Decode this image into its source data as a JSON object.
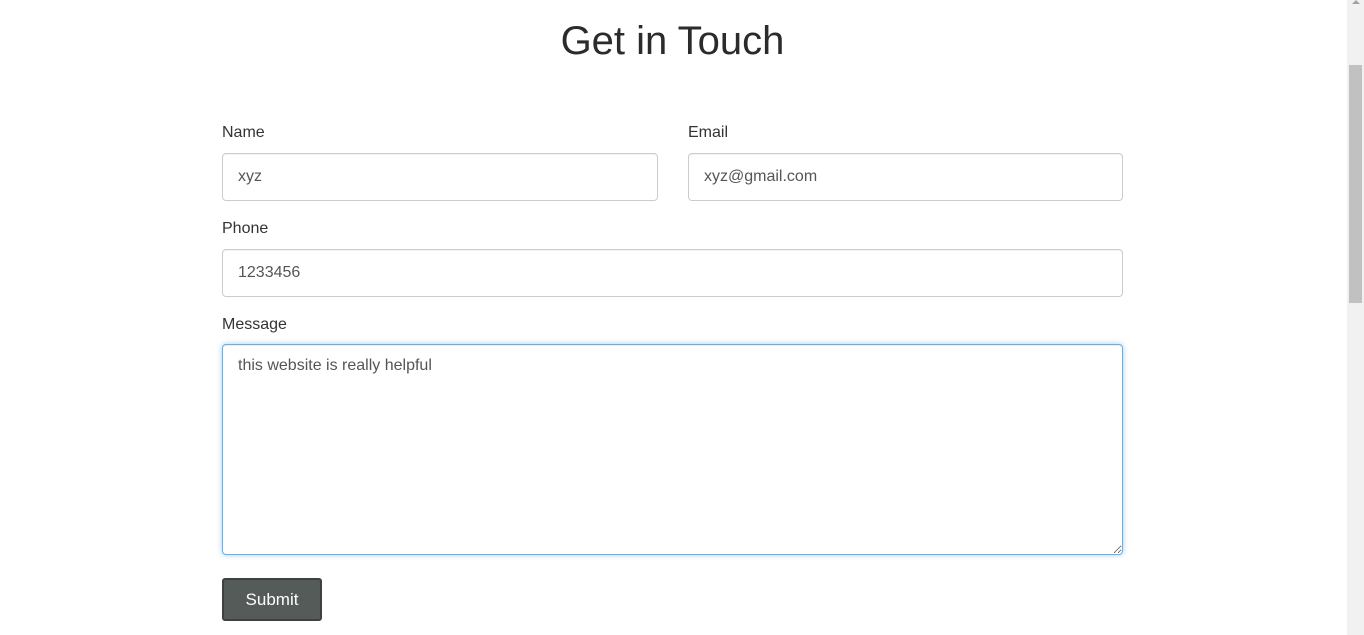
{
  "page": {
    "title": "Get in Touch"
  },
  "form": {
    "name": {
      "label": "Name",
      "value": "xyz"
    },
    "email": {
      "label": "Email",
      "value": "xyz@gmail.com"
    },
    "phone": {
      "label": "Phone",
      "value": "1233456"
    },
    "message": {
      "label": "Message",
      "value": "this website is really helpful"
    },
    "submit_label": "Submit"
  },
  "colors": {
    "focus_border": "#66afe9",
    "button_bg": "#555b58"
  }
}
